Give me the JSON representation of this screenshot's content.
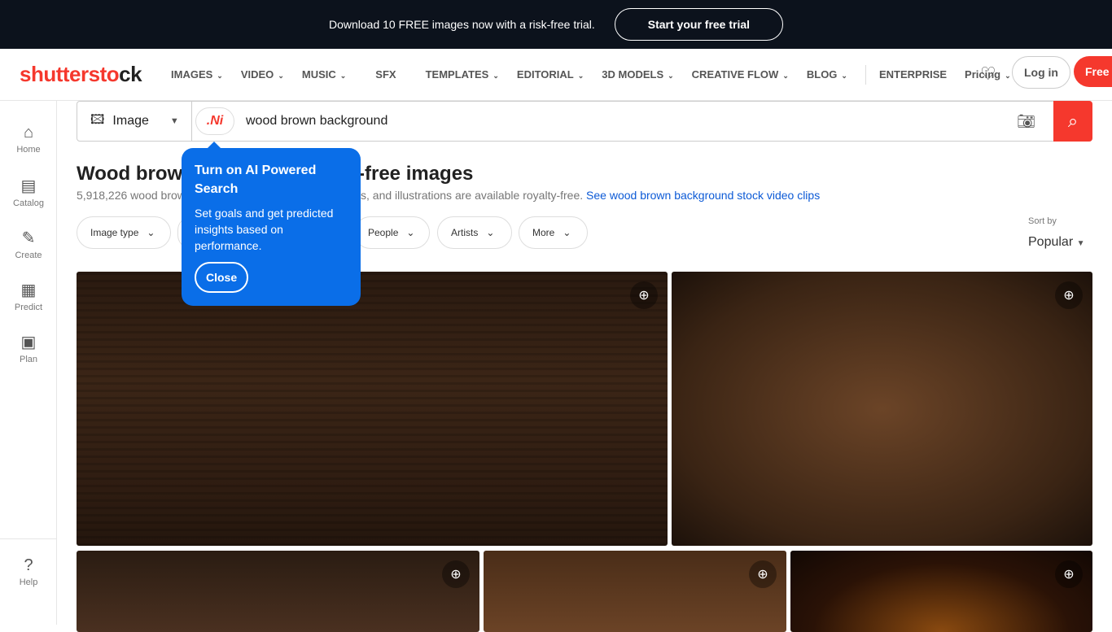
{
  "promo": {
    "text": "Download 10 FREE images now with a risk-free trial.",
    "cta": "Start your free trial"
  },
  "nav": {
    "logo": "shutterstock",
    "items": [
      {
        "label": "IMAGES",
        "dd": true
      },
      {
        "label": "VIDEO",
        "dd": true
      },
      {
        "label": "MUSIC",
        "dd": true
      },
      {
        "label": "SFX",
        "dd": false
      },
      {
        "label": "TEMPLATES",
        "dd": true
      },
      {
        "label": "EDITORIAL",
        "dd": true
      },
      {
        "label": "3D MODELS",
        "dd": true
      },
      {
        "label": "CREATIVE FLOW",
        "dd": true
      },
      {
        "label": "BLOG",
        "dd": true
      }
    ],
    "enterprise": "ENTERPRISE",
    "pricing": "Pricing",
    "login": "Log in",
    "free": "Free trial"
  },
  "sidebar": {
    "items": [
      {
        "label": "Home",
        "icon": "⌂"
      },
      {
        "label": "Catalog",
        "icon": "▤"
      },
      {
        "label": "Create",
        "icon": "✎"
      },
      {
        "label": "Predict",
        "icon": "▦"
      },
      {
        "label": "Plan",
        "icon": "▣"
      }
    ],
    "help": "Help"
  },
  "search": {
    "type": "Image",
    "ai": ".Ni",
    "value": "wood brown background"
  },
  "results": {
    "title_start": "Wood brown",
    "title_end": "-free images",
    "count_start": "5,918,226 wood brow",
    "count_end": "s, and illustrations are available royalty-free.",
    "video_link": "See wood brown background stock video clips"
  },
  "filters": [
    "Image type",
    "People",
    "Artists",
    "More"
  ],
  "sort": {
    "label": "Sort by",
    "value": "Popular"
  },
  "tooltip": {
    "title": "Turn on AI Powered Search",
    "body": "Set goals and get predicted insights based on performance.",
    "close": "Close"
  }
}
